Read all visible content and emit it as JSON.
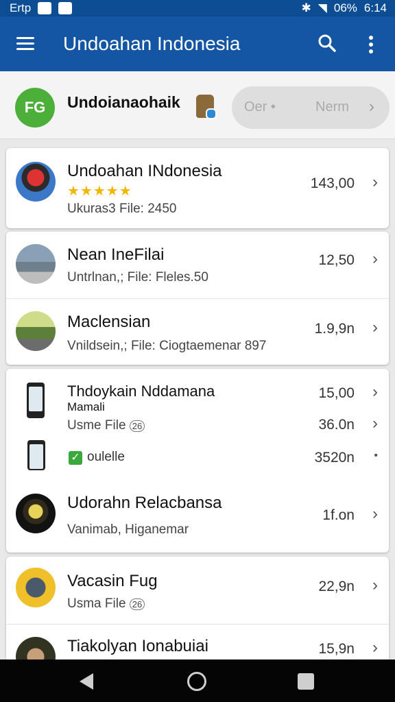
{
  "status_bar": {
    "carrier": "Ertp",
    "battery": "06%",
    "time": "6:14"
  },
  "app_bar": {
    "title": "Undoahan Indonesia"
  },
  "profile": {
    "logo_text": "FG",
    "name": "Undoianaohaik",
    "pill_left": "Oer •",
    "pill_right": "Nerm"
  },
  "items": [
    {
      "title": "Undoahan INdonesia",
      "rating": "★★★★★",
      "subtitle": "Ukuras3 File: 2450",
      "value": "143,00"
    },
    {
      "title": "Nean IneFilai",
      "subtitle": "Untrlnan,; File: Fleles.50",
      "value": "12,50"
    },
    {
      "title": "Maclensian",
      "subtitle": "Vnildsein,; File: Ciogtaemenar 897",
      "value": "1.9,9n"
    },
    {
      "title": "Thdoykain Nddamana",
      "title2": "Mamali",
      "subtitle": "Usme File",
      "subtitle_badge": "26",
      "value": "15,00",
      "value2": "36.0n"
    },
    {
      "title": "oulelle",
      "value": "3520n"
    },
    {
      "title": "Udorahn Relacbansa",
      "subtitle": "Vanimab, Higanemar",
      "value": "1f.on"
    },
    {
      "title": "Vacasin Fug",
      "subtitle": "Usma File",
      "subtitle_badge": "26",
      "value": "22,9n"
    },
    {
      "title": "Tiakolyan Ionabuiai",
      "value": "15,9n"
    }
  ],
  "colors": {
    "app_bar": "#1456a4",
    "status_bar": "#0d4d93",
    "logo": "#4caf3a",
    "star": "#f2b600"
  }
}
